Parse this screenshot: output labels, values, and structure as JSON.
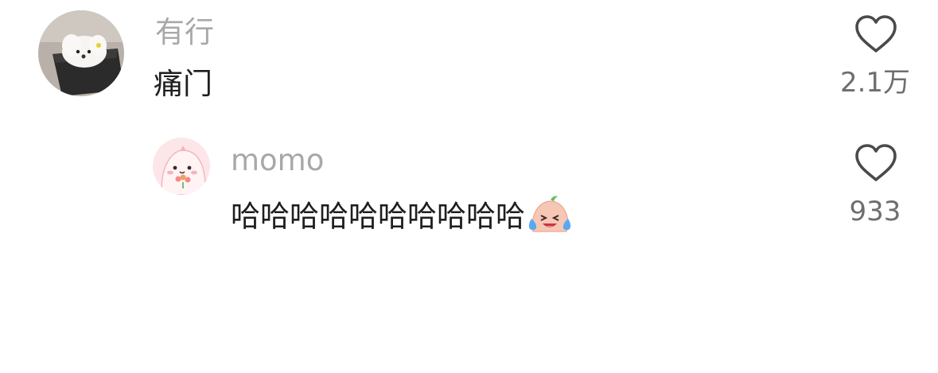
{
  "comments": [
    {
      "username": "有行",
      "text": "痛门",
      "likes": "2.1万",
      "avatar_icon": "dog-photo-avatar"
    },
    {
      "username": "momo",
      "text": "哈哈哈哈哈哈哈哈哈哈",
      "likes": "933",
      "avatar_icon": "pink-cartoon-avatar",
      "emoji_icon": "laughing-tears-emoji"
    }
  ],
  "colors": {
    "username": "#a8a8a8",
    "text": "#1e1e1e",
    "likes": "#6e6e6e",
    "heart_stroke": "#4a4a4a"
  }
}
